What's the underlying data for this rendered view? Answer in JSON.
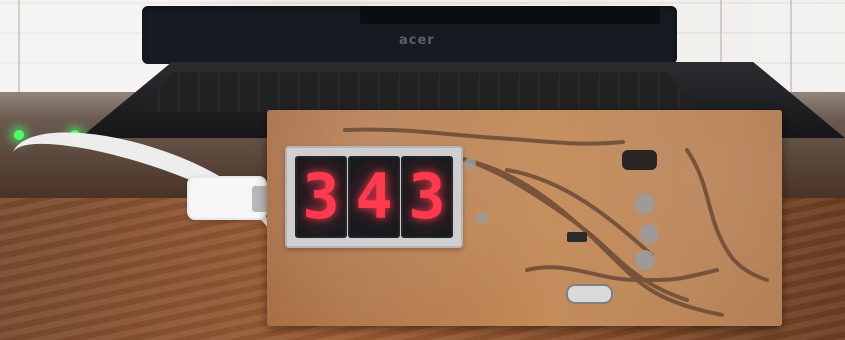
{
  "laptop": {
    "brand": "acer",
    "lid_color": "#171a20"
  },
  "status_leds": [
    {
      "color": "#49ff6b"
    },
    {
      "color": "#49ff6b"
    }
  ],
  "display": {
    "text_color": "#ff3a4f",
    "digits": [
      "3",
      "4",
      "3"
    ]
  },
  "icons": [
    "usb-cable-icon",
    "pcb-board-icon",
    "seven-segment-display-icon",
    "transistor-icon",
    "capacitor-icon",
    "crystal-oscillator-icon"
  ]
}
